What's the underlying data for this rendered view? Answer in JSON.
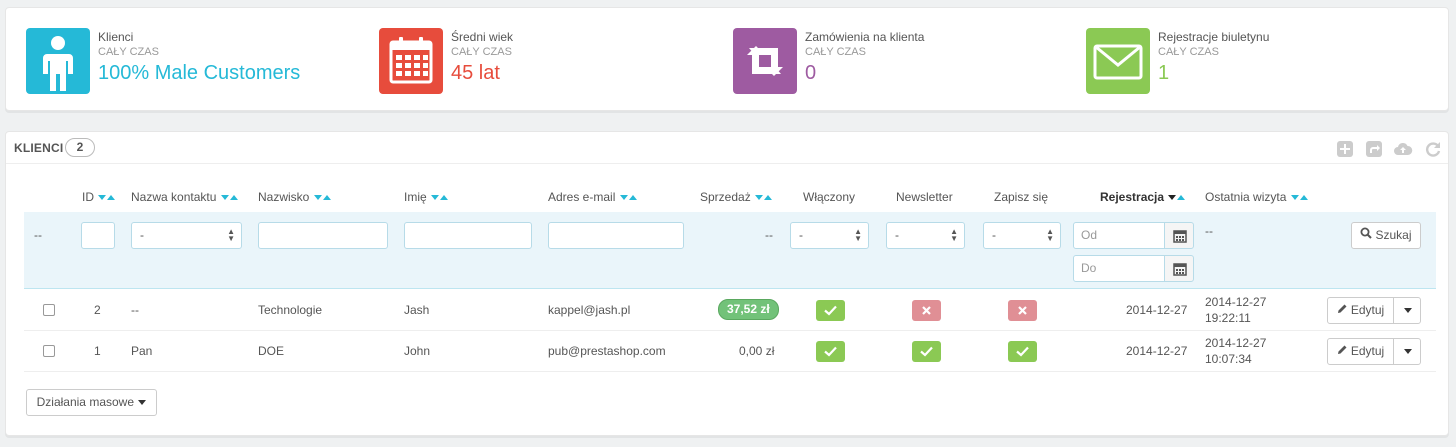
{
  "kpis": [
    {
      "title": "Klienci",
      "sub": "CAŁY CZAS",
      "value": "100% Male Customers",
      "color": "#25b9d7",
      "icon": "user-icon"
    },
    {
      "title": "Średni wiek",
      "sub": "CAŁY CZAS",
      "value": "45 lat",
      "color": "#e74c3c",
      "icon": "calendar-icon"
    },
    {
      "title": "Zamówienia na klienta",
      "sub": "CAŁY CZAS",
      "value": "0",
      "color": "#9e5ba1",
      "icon": "retweet-icon"
    },
    {
      "title": "Rejestracje biuletynu",
      "sub": "CAŁY CZAS",
      "value": "1",
      "color": "#8bc954",
      "icon": "envelope-icon"
    }
  ],
  "panel": {
    "title": "KLIENCI",
    "count": "2"
  },
  "columns": {
    "id": "ID",
    "contact": "Nazwa kontaktu",
    "lastname": "Nazwisko",
    "firstname": "Imię",
    "email": "Adres e-mail",
    "sales": "Sprzedaż",
    "enabled": "Włączony",
    "newsletter": "Newsletter",
    "optin": "Zapisz się",
    "registration": "Rejestracja",
    "last_visit": "Ostatnia wizyta"
  },
  "filters": {
    "dash_left": "--",
    "contact_select": "-",
    "sales_dash": "--",
    "enabled_select": "-",
    "newsletter_select": "-",
    "optin_select": "-",
    "date_from_placeholder": "Od",
    "date_to_placeholder": "Do",
    "last_visit_dash": "--",
    "search_label": "Szukaj"
  },
  "rows": [
    {
      "id": "2",
      "contact": "--",
      "lastname": "Technologie",
      "firstname": "Jash",
      "email": "kappel@jash.pl",
      "sales": "37,52 zł",
      "sales_badge": true,
      "enabled": true,
      "newsletter": false,
      "optin": false,
      "registration": "2014-12-27",
      "last_visit_date": "2014-12-27",
      "last_visit_time": "19:22:11",
      "edit": "Edytuj"
    },
    {
      "id": "1",
      "contact": "Pan",
      "lastname": "DOE",
      "firstname": "John",
      "email": "pub@prestashop.com",
      "sales": "0,00 zł",
      "sales_badge": false,
      "enabled": true,
      "newsletter": true,
      "optin": true,
      "registration": "2014-12-27",
      "last_visit_date": "2014-12-27",
      "last_visit_time": "10:07:34",
      "edit": "Edytuj"
    }
  ],
  "bulk_actions": "Działania masowe"
}
